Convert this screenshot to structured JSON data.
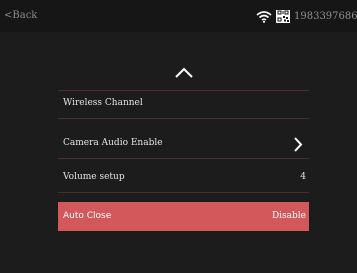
{
  "header": {
    "back_label": "Back",
    "device_id": "1983397686",
    "icons": [
      "wifi-icon",
      "qr-code-icon"
    ]
  },
  "menu": {
    "items": [
      {
        "label": "Wireless Channel",
        "value": ""
      },
      {
        "label": "Camera Audio Enable",
        "value": ""
      },
      {
        "label": "Volume setup",
        "value": "4"
      },
      {
        "label": "Auto Close",
        "value": "Disable"
      }
    ],
    "selected_index": 3
  },
  "colors": {
    "background": "#1c1c1c",
    "selected_row": "#d3585b",
    "divider": "#4a2e32",
    "text": "#e4e4e4"
  }
}
